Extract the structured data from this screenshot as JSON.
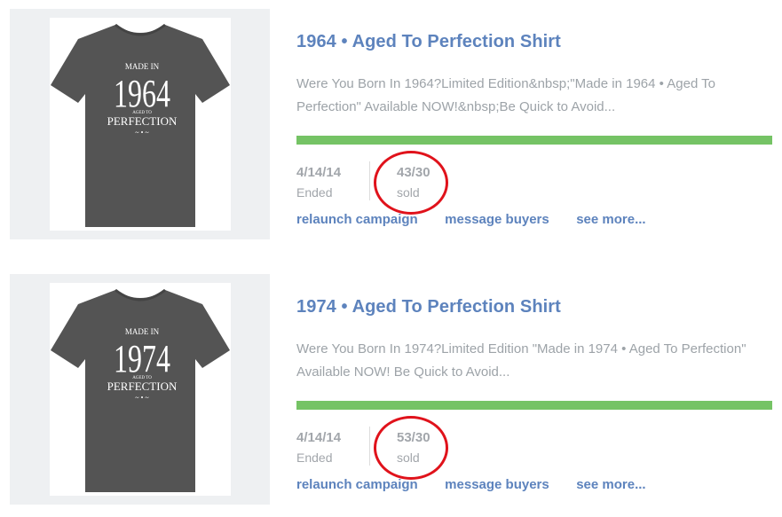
{
  "campaigns": [
    {
      "title": "1964 • Aged To Perfection Shirt",
      "description": "Were You Born In 1964?Limited Edition&nbsp;\"Made in 1964 • Aged To Perfection\" Available NOW!&nbsp;Be Quick to Avoid...",
      "shirt": {
        "line1": "MADE IN",
        "year": "1964",
        "line2": "AGED TO",
        "line3": "PERFECTION",
        "ornament": "~ • ~"
      },
      "progress_fraction": 1.0,
      "date": "4/14/14",
      "date_label": "Ended",
      "sold": "43/30",
      "sold_label": "sold",
      "actions": {
        "relaunch": "relaunch campaign",
        "message": "message buyers",
        "more": "see more..."
      }
    },
    {
      "title": "1974 • Aged To Perfection Shirt",
      "description": "Were You Born In 1974?Limited Edition \"Made in 1974 • Aged To Perfection\" Available NOW! Be Quick to Avoid...",
      "shirt": {
        "line1": "MADE IN",
        "year": "1974",
        "line2": "AGED TO",
        "line3": "PERFECTION",
        "ornament": "~ • ~"
      },
      "progress_fraction": 1.0,
      "date": "4/14/14",
      "date_label": "Ended",
      "sold": "53/30",
      "sold_label": "sold",
      "actions": {
        "relaunch": "relaunch campaign",
        "message": "message buyers",
        "more": "see more..."
      }
    }
  ],
  "colors": {
    "title": "#5d83bd",
    "progress": "#75c365",
    "shirt": "#545454",
    "highlight": "#e0121b"
  }
}
